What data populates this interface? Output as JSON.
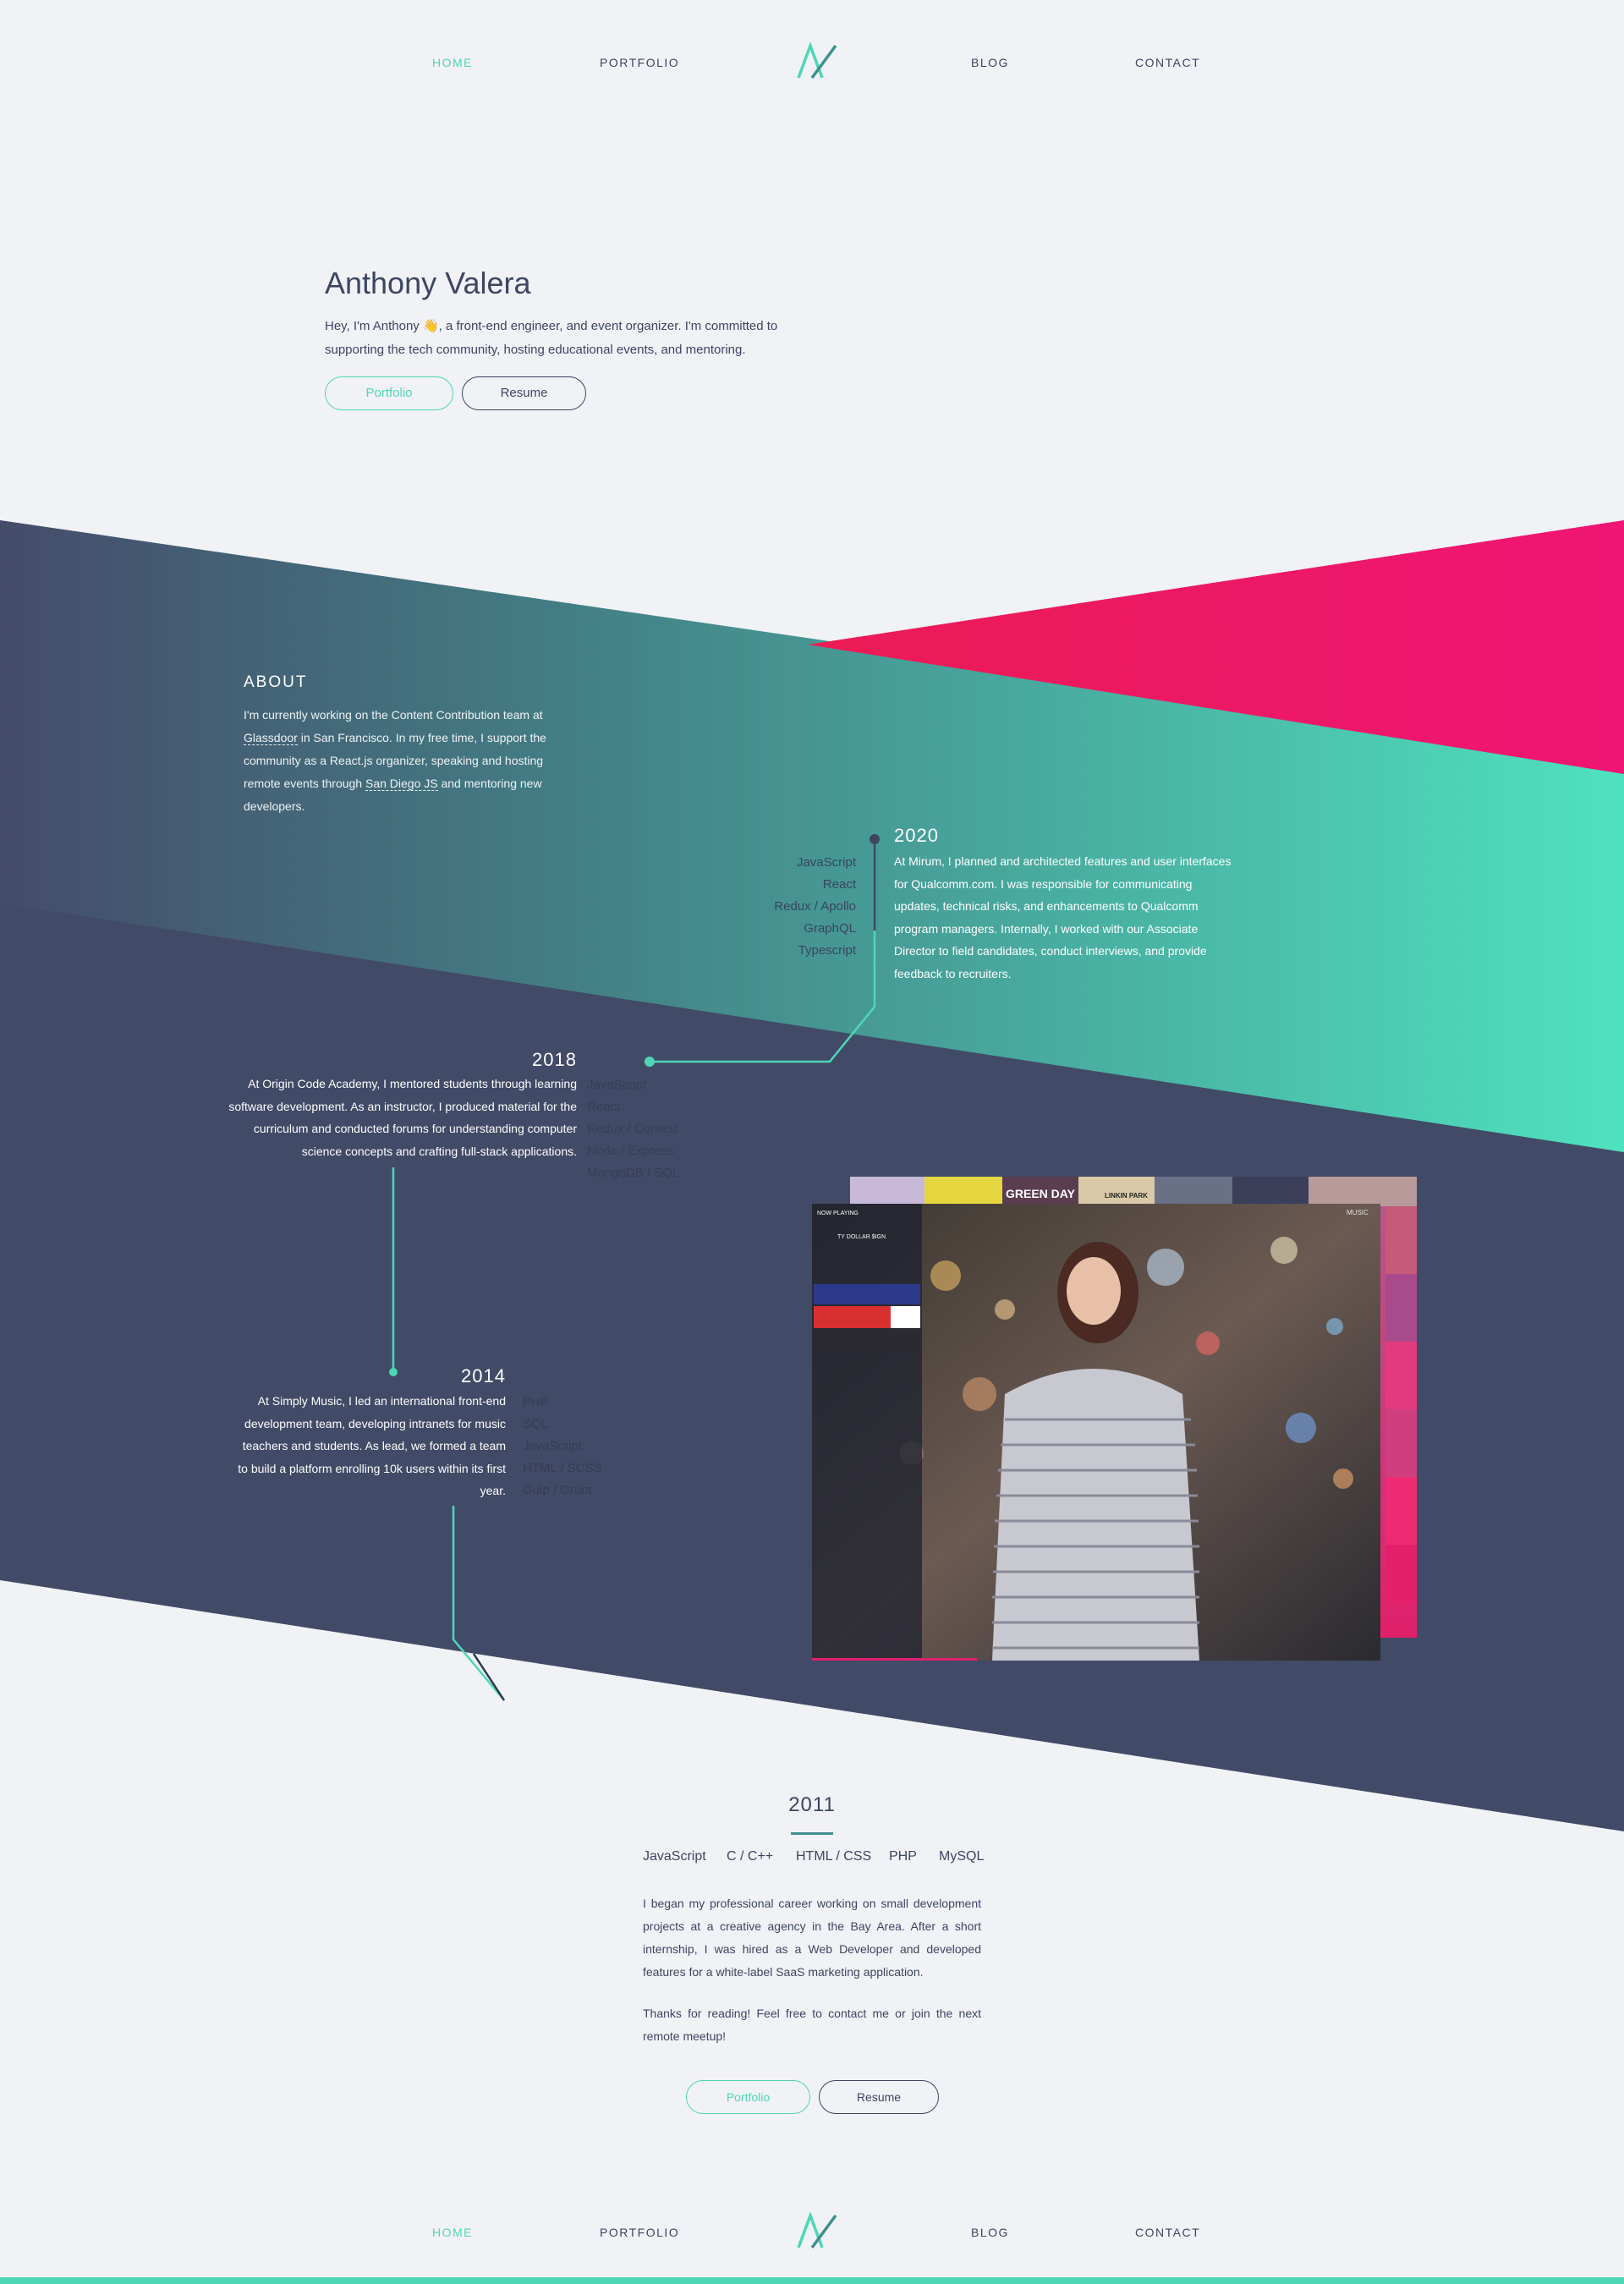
{
  "nav": {
    "home": "HOME",
    "portfolio": "PORTFOLIO",
    "blog": "BLOG",
    "contact": "CONTACT",
    "logo_text": "AV"
  },
  "hero": {
    "title": "Anthony Valera",
    "intro_before": "Hey, I'm Anthony ",
    "wave_emoji": "👋",
    "intro_after": ", a front-end engineer, and event organizer. I'm committed to supporting the tech community, hosting educational events, and mentoring.",
    "primary_button": "Portfolio",
    "secondary_button": "Resume"
  },
  "about": {
    "heading": "ABOUT",
    "text_1": "I'm currently working on the Content Contribution team at ",
    "link_1": "Glassdoor",
    "text_2": " in San Francisco. In my free time, I support the community as a React.js organizer, speaking and hosting remote events through ",
    "link_2": "San Diego JS",
    "text_3": " and mentoring new developers."
  },
  "timeline": [
    {
      "year": "2020",
      "text": "At Mirum, I planned and architected features and user interfaces for Qualcomm.com. I was responsible for communicating updates, technical risks, and enhancements to Qualcomm program managers. Internally, I worked with our Associate Director to field candidates, conduct interviews, and provide feedback to recruiters.",
      "skills": [
        "JavaScript",
        "React",
        "Redux / Apollo",
        "GraphQL",
        "Typescript"
      ]
    },
    {
      "year": "2018",
      "text": "At Origin Code Academy, I mentored students through learning software development. As an instructor, I produced material for the curriculum and conducted forums for understanding computer science concepts and crafting full-stack applications.",
      "skills": [
        "JavaScript",
        "React",
        "Redux / Context",
        "Node / Express",
        "MongoDB / SQL"
      ]
    },
    {
      "year": "2014",
      "text": "At Simply Music, I led an international front-end development team, developing intranets for music teachers and students. As lead, we formed a team to build a platform enrolling 10k users within its first year.",
      "skills": [
        "PHP",
        "SQL",
        "JavaScript",
        "HTML / SCSS",
        "Gulp / Grunt"
      ]
    }
  ],
  "collage": {
    "now_playing": "NOW PLAYING",
    "track": "TY DOLLAR $IGN",
    "top_label": "MUSIC",
    "band_tiles": [
      "GREEN DAY",
      "LINKIN PARK"
    ]
  },
  "final": {
    "year": "2011",
    "skills": [
      "JavaScript",
      "C / C++",
      "HTML / CSS",
      "PHP",
      "MySQL"
    ],
    "paragraph_1": "I began my professional career working on small development projects at a creative agency in the Bay Area. After a short internship, I was hired as a Web Developer and developed features for a white-label SaaS marketing application.",
    "paragraph_2": "Thanks for reading! Feel free to contact me or join the next remote meetup!",
    "primary_button": "Portfolio",
    "secondary_button": "Resume"
  },
  "colors": {
    "accent": "#4fd6b5",
    "navy": "#414a66",
    "pink": "#f0146a",
    "background": "#f0f2f6"
  }
}
